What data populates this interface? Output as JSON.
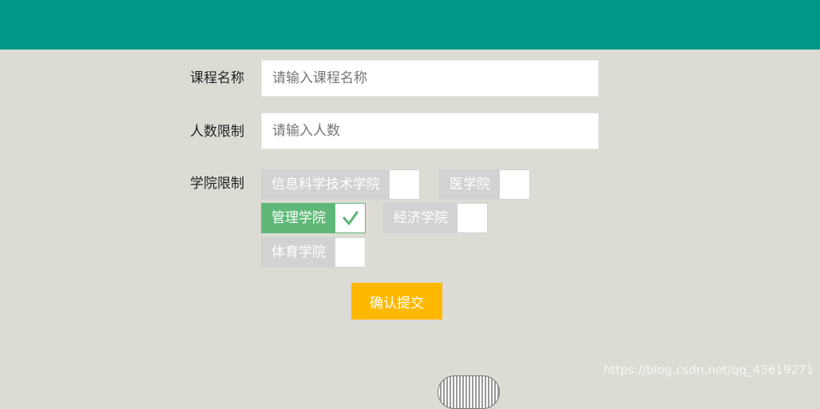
{
  "form": {
    "course_name_label": "课程名称",
    "course_name_placeholder": "请输入课程名称",
    "capacity_label": "人数限制",
    "capacity_placeholder": "请输入人数",
    "college_label": "学院限制",
    "colleges": [
      {
        "label": "信息科学技术学院",
        "checked": false
      },
      {
        "label": "医学院",
        "checked": false
      },
      {
        "label": "管理学院",
        "checked": true
      },
      {
        "label": "经济学院",
        "checked": false
      },
      {
        "label": "体育学院",
        "checked": false
      }
    ],
    "submit_label": "确认提交"
  },
  "watermark": "https://blog.csdn.net/qq_43619271",
  "colors": {
    "header": "#009688",
    "background": "#dcdcd5",
    "checked": "#5fb878",
    "unchecked": "#d2d2d2",
    "submit": "#ffb800"
  }
}
